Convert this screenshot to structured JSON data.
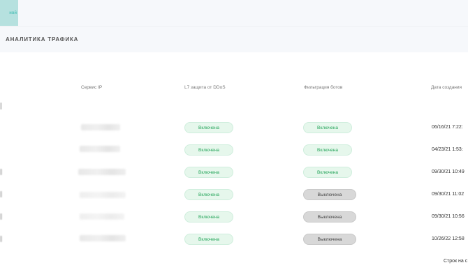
{
  "header": {
    "active_tab_label": "ной"
  },
  "section": {
    "title": "АНАЛИТИКА ТРАФИКА"
  },
  "table": {
    "columns": {
      "ip": "Сервис IP",
      "l7": "L7 защита от DDoS",
      "bots": "Фильтрация ботов",
      "date": "Дата создания"
    },
    "rows": [
      {
        "l7": "Включена",
        "bots": "Включена",
        "bots_state": "on",
        "date": "06/16/21 7:22:"
      },
      {
        "l7": "Включена",
        "bots": "Включена",
        "bots_state": "on",
        "date": "04/23/21 1:53:"
      },
      {
        "l7": "Включена",
        "bots": "Включена",
        "bots_state": "on",
        "date": "09/30/21 10:49"
      },
      {
        "l7": "Включена",
        "bots": "Выключена",
        "bots_state": "off",
        "date": "09/30/21 11:02"
      },
      {
        "l7": "Включена",
        "bots": "Выключена",
        "bots_state": "off",
        "date": "09/30/21 10:56"
      },
      {
        "l7": "Включена",
        "bots": "Выключена",
        "bots_state": "off",
        "date": "10/26/22 12:58"
      }
    ]
  },
  "footer": {
    "rows_per_page_label": "Строк на с"
  },
  "colors": {
    "accent": "#2bb6ab",
    "enabled_text": "#25a55a",
    "enabled_bg": "#e6f7ec",
    "disabled_bg": "#d8d8d8"
  }
}
